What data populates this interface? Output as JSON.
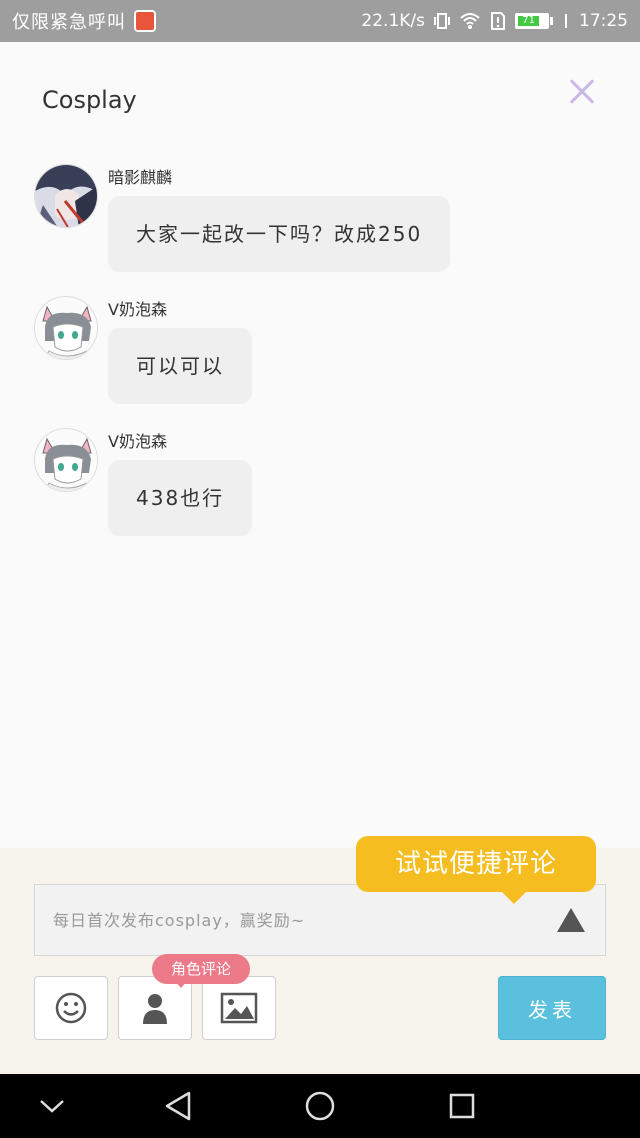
{
  "status_bar": {
    "left_text": "仅限紧急呼叫",
    "net_speed": "22.1K/s",
    "battery_level": "71",
    "time": "17:25"
  },
  "header": {
    "title": "Cosplay"
  },
  "messages": [
    {
      "username": "暗影麒麟",
      "text": "大家一起改一下吗？改成250",
      "avatar": "dark-anime-avatar"
    },
    {
      "username": "V奶泡森",
      "text": "可以可以",
      "avatar": "cat-ear-anime-avatar"
    },
    {
      "username": "V奶泡森",
      "text": "438也行",
      "avatar": "cat-ear-anime-avatar"
    }
  ],
  "composer": {
    "tip_text": "试试便捷评论",
    "placeholder": "每日首次发布cosplay，赢奖励~",
    "role_tag": "角色评论",
    "publish_label": "发表"
  },
  "colors": {
    "tip_yellow": "#f5bd1f",
    "role_pink": "#ec7a88",
    "publish_blue": "#5bc0de",
    "close_purple": "#c9b8e8"
  }
}
